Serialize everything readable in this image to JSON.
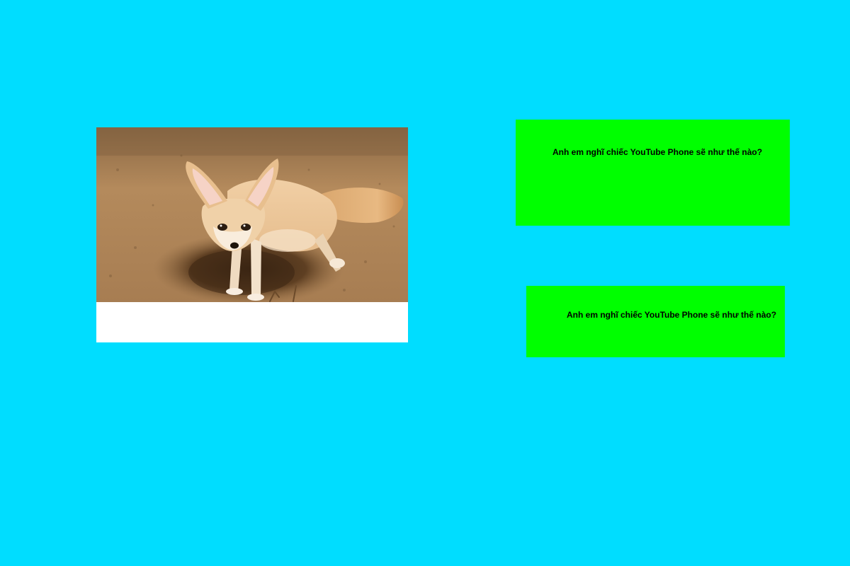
{
  "page": {
    "background_color": "#00DDFF",
    "box_color": "#00FF00",
    "photo_card_background": "#FFFFFF"
  },
  "photo": {
    "subject": "fennec-fox",
    "alt": "Fennec fox standing at a burrow in sand"
  },
  "boxes": [
    {
      "text": "Anh em nghĩ chiếc YouTube Phone sẽ như thế nào?"
    },
    {
      "text": "Anh em nghĩ chiếc YouTube Phone sẽ như thế nào?"
    }
  ]
}
